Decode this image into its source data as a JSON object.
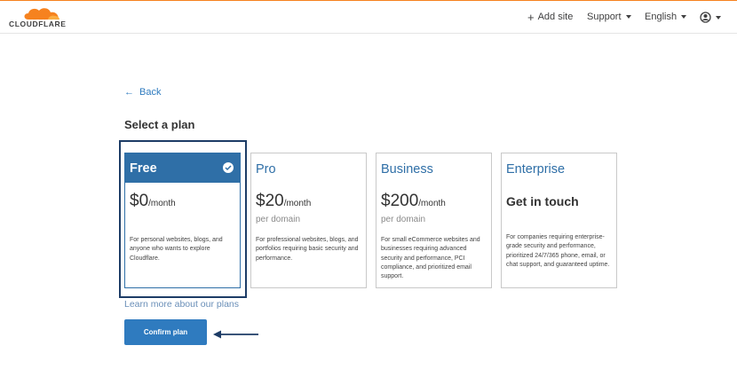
{
  "header": {
    "logo_text": "CLOUDFLARE",
    "add_site": "Add site",
    "support": "Support",
    "language": "English"
  },
  "back_label": "Back",
  "page_title": "Select a plan",
  "plans": [
    {
      "name": "Free",
      "price": "$0",
      "unit": "/month",
      "sub": "",
      "selected": true,
      "desc": "For personal websites, blogs, and anyone who wants to explore Cloudflare."
    },
    {
      "name": "Pro",
      "price": "$20",
      "unit": "/month",
      "sub": "per domain",
      "selected": false,
      "desc": "For professional websites, blogs, and portfolios requiring basic security and performance."
    },
    {
      "name": "Business",
      "price": "$200",
      "unit": "/month",
      "sub": "per domain",
      "selected": false,
      "desc": "For small eCommerce websites and businesses requiring advanced security and performance, PCI compliance, and prioritized email support."
    },
    {
      "name": "Enterprise",
      "price": "Get in touch",
      "unit": "",
      "sub": "",
      "selected": false,
      "desc": "For companies requiring enterprise-grade security and performance, prioritized 24/7/365 phone, email, or chat support, and guaranteed uptime."
    }
  ],
  "learn_more": "Learn more about our plans",
  "confirm_label": "Confirm plan",
  "colors": {
    "accent": "#2f6fa7",
    "brand_orange": "#f6821f",
    "button": "#2f7bbf"
  }
}
